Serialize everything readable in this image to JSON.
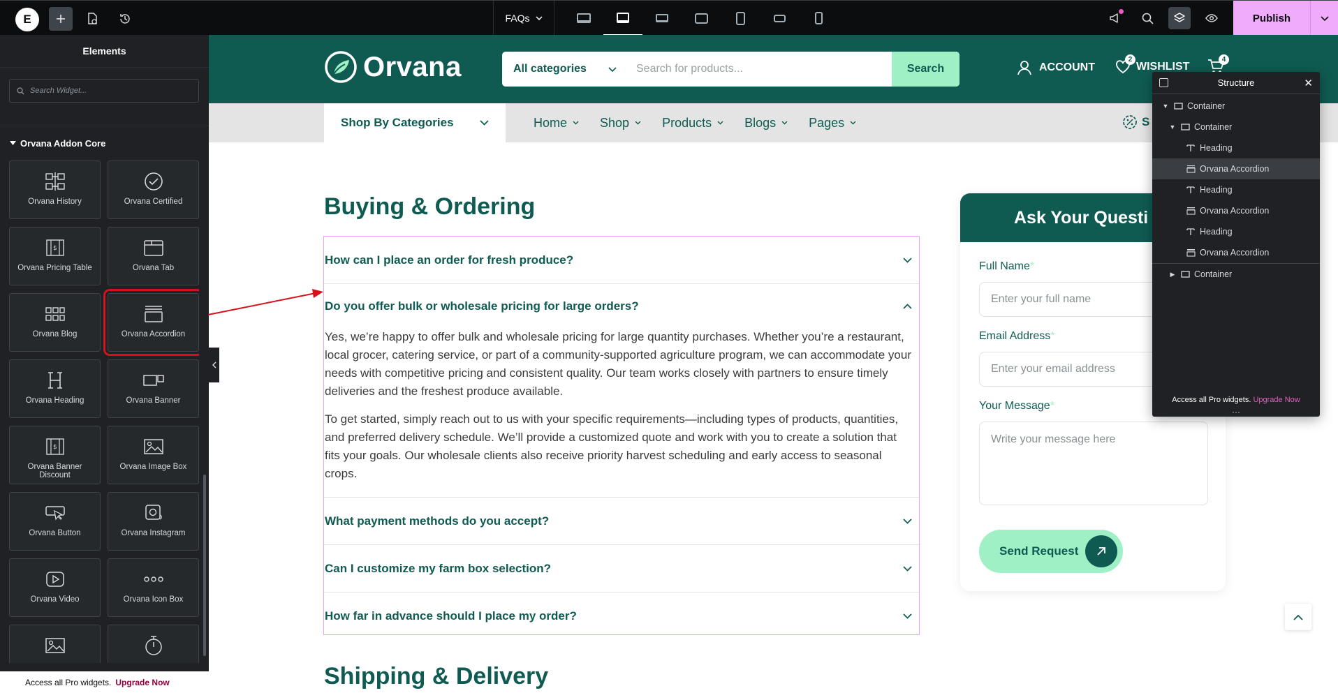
{
  "topbar": {
    "logo_letter": "E",
    "page_name": "FAQs",
    "publish_label": "Publish"
  },
  "panel": {
    "title": "Elements",
    "search_placeholder": "Search Widget...",
    "category": "Orvana Addon Core",
    "widgets": [
      {
        "label": "Orvana History",
        "icon": "history-icon"
      },
      {
        "label": "Orvana Certified",
        "icon": "check-circle-icon"
      },
      {
        "label": "Orvana Pricing Table",
        "icon": "pricing-table-icon"
      },
      {
        "label": "Orvana Tab",
        "icon": "tab-icon"
      },
      {
        "label": "Orvana Blog",
        "icon": "grid-icon"
      },
      {
        "label": "Orvana Accordion",
        "icon": "accordion-icon"
      },
      {
        "label": "Orvana Heading",
        "icon": "heading-icon"
      },
      {
        "label": "Orvana Banner",
        "icon": "banner-icon"
      },
      {
        "label": "Orvana Banner Discount",
        "icon": "banner-discount-icon"
      },
      {
        "label": "Orvana Image Box",
        "icon": "image-icon"
      },
      {
        "label": "Orvana Button",
        "icon": "button-icon"
      },
      {
        "label": "Orvana Instagram",
        "icon": "instagram-icon"
      },
      {
        "label": "Orvana Video",
        "icon": "video-icon"
      },
      {
        "label": "Orvana Icon Box",
        "icon": "dots-icon"
      },
      {
        "label": "",
        "icon": "image-icon"
      },
      {
        "label": "",
        "icon": "timer-icon"
      }
    ],
    "footer_text": "Access all Pro widgets.",
    "footer_link": "Upgrade Now"
  },
  "site": {
    "logo": "Orvana",
    "search_category": "All categories",
    "search_placeholder": "Search for products...",
    "search_button": "Search",
    "account": "ACCOUNT",
    "wishlist": "WISHLIST",
    "wishlist_count": "2",
    "cart_count": "4",
    "shop_by": "Shop By Categories",
    "nav": [
      "Home",
      "Shop",
      "Products",
      "Blogs",
      "Pages"
    ],
    "nav_right": "S"
  },
  "faq": {
    "section1": "Buying & Ordering",
    "section2": "Shipping & Delivery",
    "items": [
      {
        "q": "How can I place an order for fresh produce?"
      },
      {
        "q": "Do you offer bulk or wholesale pricing for large orders?",
        "a1": "Yes, we’re happy to offer bulk and wholesale pricing for large quantity purchases. Whether you’re a restaurant, local grocer, catering service, or part of a community-supported agriculture program, we can accommodate your needs with competitive pricing and consistent quality. Our team works closely with partners to ensure timely deliveries and the freshest produce available.",
        "a2": "To get started, simply reach out to us with your specific requirements—including types of products, quantities, and preferred delivery schedule. We’ll provide a customized quote and work with you to create a solution that fits your goals. Our wholesale clients also receive priority harvest scheduling and early access to seasonal crops."
      },
      {
        "q": "What payment methods do you accept?"
      },
      {
        "q": "Can I customize my farm box selection?"
      },
      {
        "q": "How far in advance should I place my order?"
      }
    ]
  },
  "form": {
    "title": "Ask Your Questi",
    "name_label": "Full Name",
    "name_placeholder": "Enter your full name",
    "email_label": "Email Address",
    "email_placeholder": "Enter your email address",
    "message_label": "Your Message",
    "message_placeholder": "Write your message here",
    "required_mark": "*",
    "send_label": "Send Request"
  },
  "structure": {
    "title": "Structure",
    "rows": [
      {
        "label": "Container",
        "level": 0,
        "caret": "open",
        "icon": "container-icon"
      },
      {
        "label": "Container",
        "level": 1,
        "caret": "open",
        "icon": "container-icon"
      },
      {
        "label": "Heading",
        "level": 2,
        "caret": "",
        "icon": "heading-t-icon"
      },
      {
        "label": "Orvana Accordion",
        "level": 2,
        "caret": "",
        "icon": "accordion-icon",
        "selected": true
      },
      {
        "label": "Heading",
        "level": 2,
        "caret": "",
        "icon": "heading-t-icon"
      },
      {
        "label": "Orvana Accordion",
        "level": 2,
        "caret": "",
        "icon": "accordion-icon"
      },
      {
        "label": "Heading",
        "level": 2,
        "caret": "",
        "icon": "heading-t-icon"
      },
      {
        "label": "Orvana Accordion",
        "level": 2,
        "caret": "",
        "icon": "accordion-icon"
      },
      {
        "label": "Container",
        "level": 1,
        "caret": "closed",
        "icon": "container-icon"
      }
    ],
    "footer_text": "Access all Pro widgets.",
    "footer_link": "Upgrade Now"
  },
  "colors": {
    "brand_green": "#0f5b52",
    "mint": "#9ff0c4",
    "publish_pink": "#f0abfc",
    "editor_dark": "#1f2124",
    "annotation_red": "#d6131b"
  }
}
